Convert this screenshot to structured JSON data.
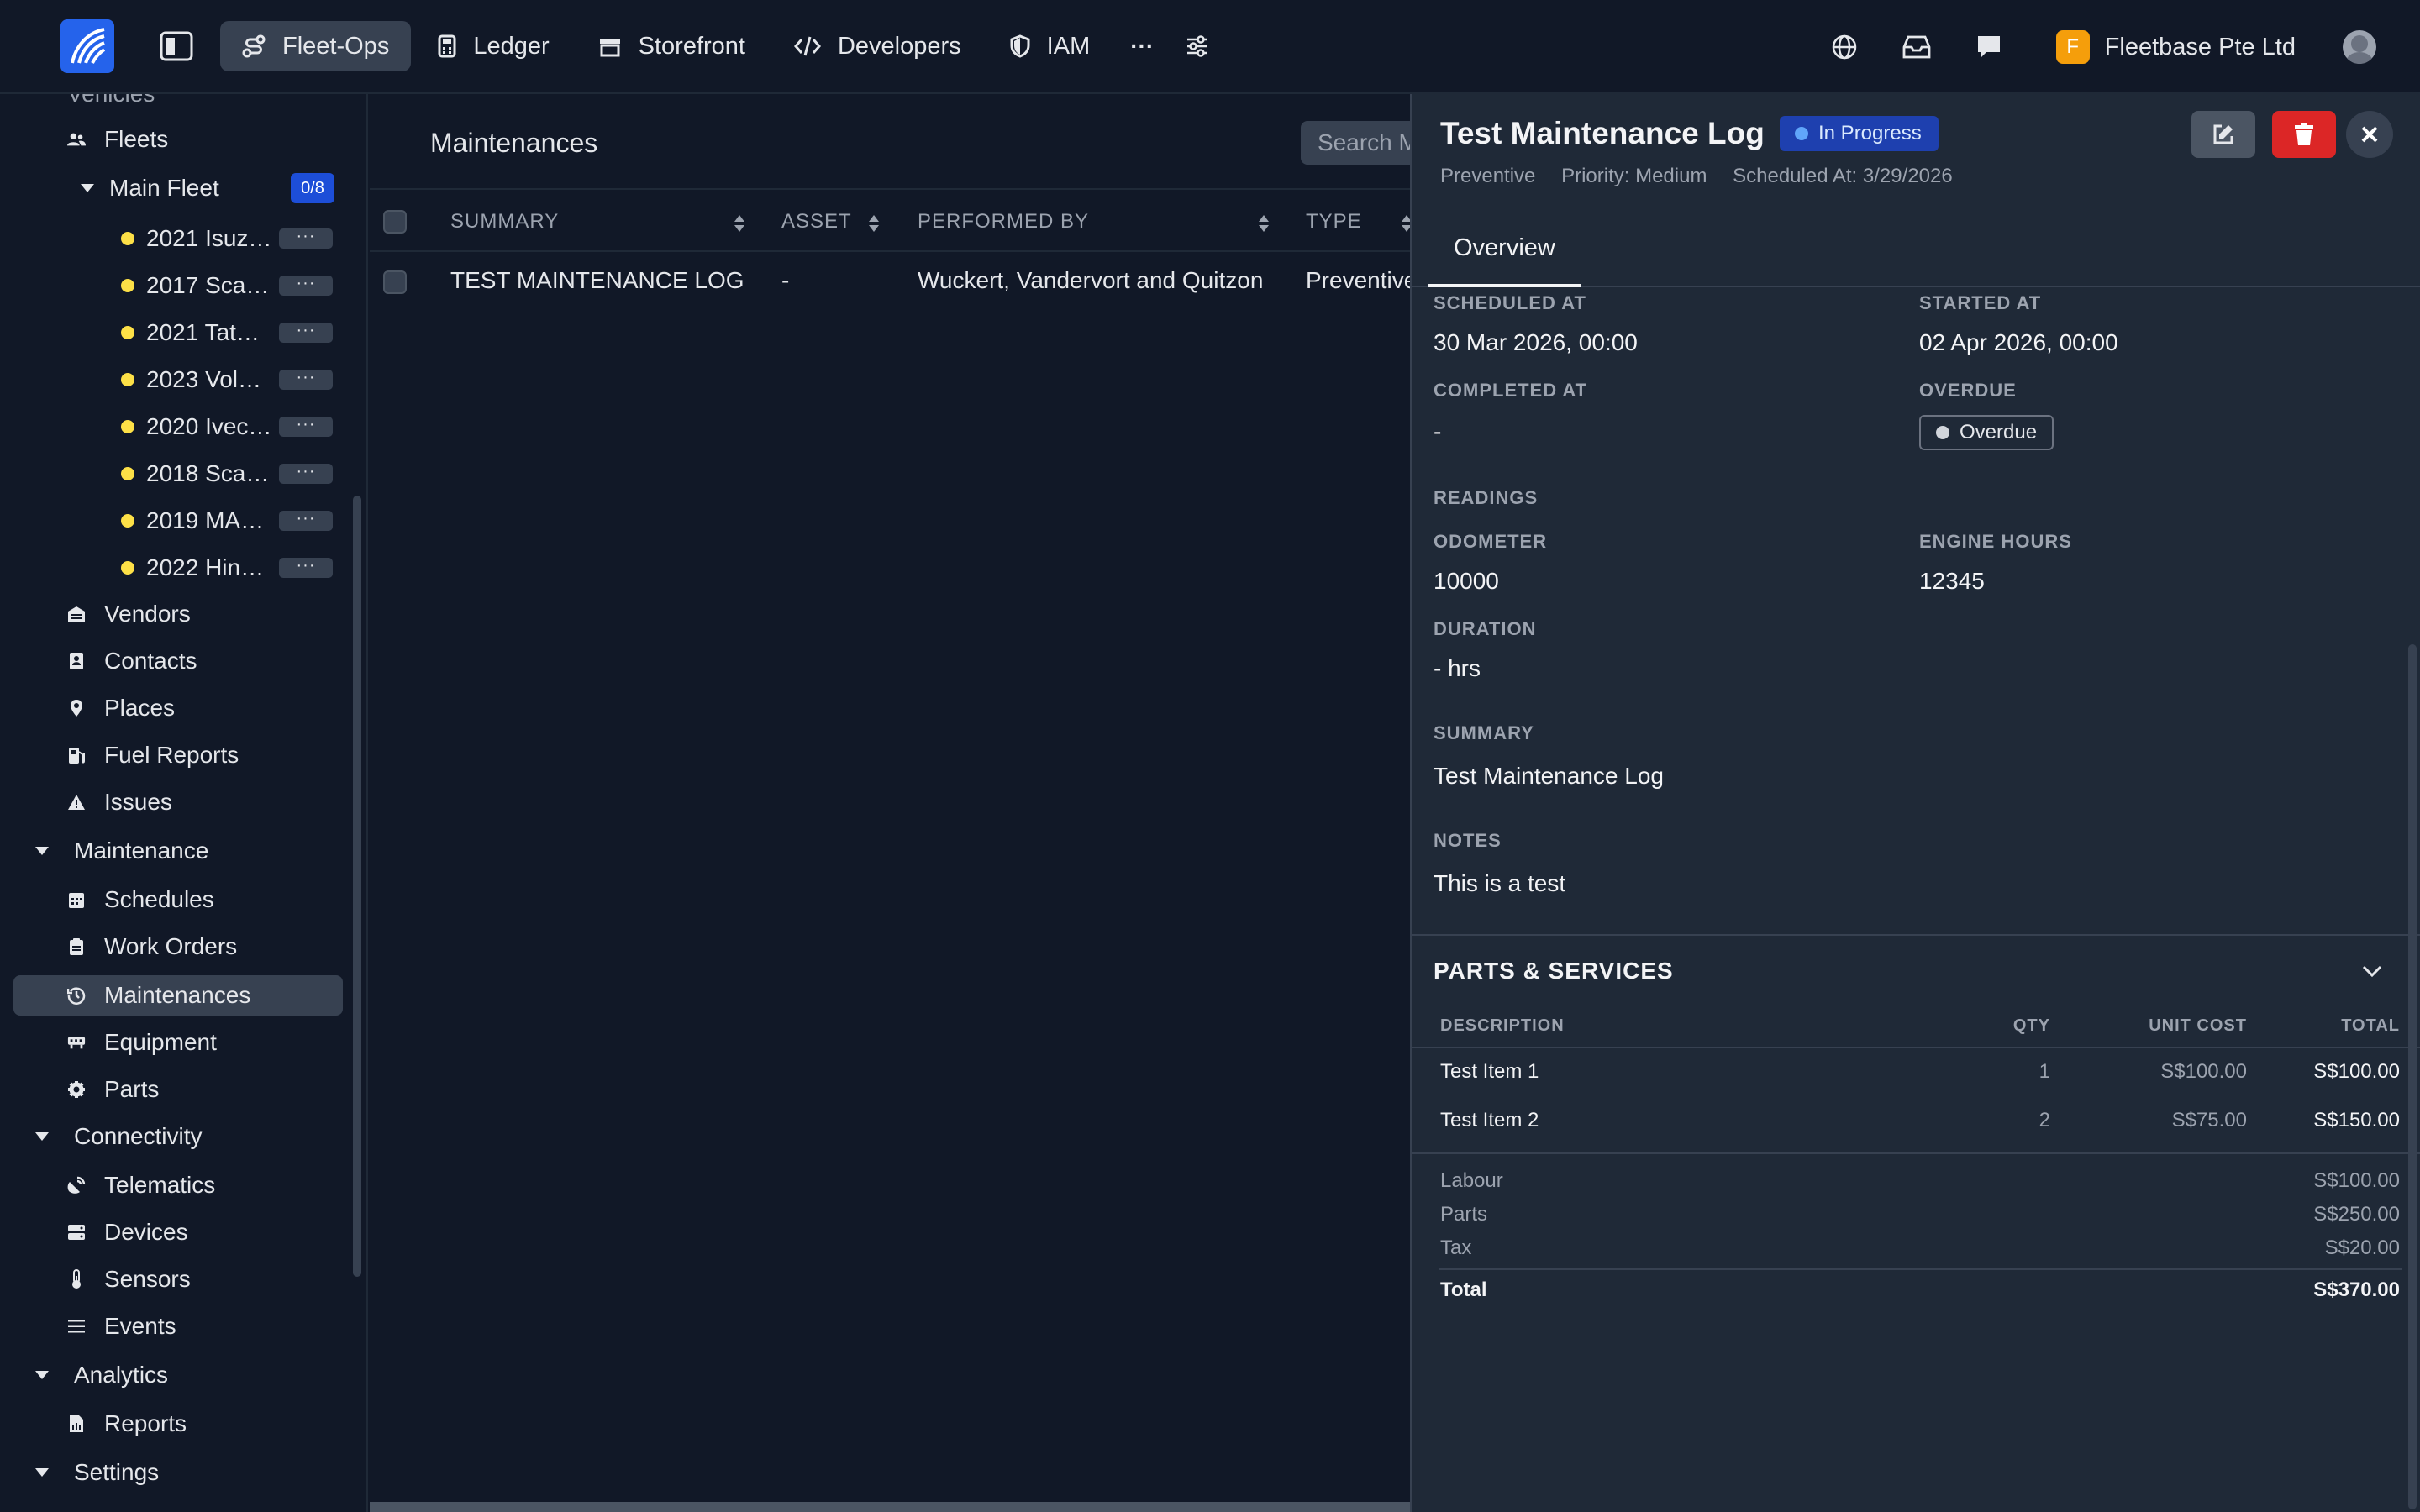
{
  "topbar": {
    "nav": [
      {
        "label": "Fleet-Ops",
        "icon": "route-icon",
        "active": true
      },
      {
        "label": "Ledger",
        "icon": "calculator-icon"
      },
      {
        "label": "Storefront",
        "icon": "store-icon"
      },
      {
        "label": "Developers",
        "icon": "code-icon"
      },
      {
        "label": "IAM",
        "icon": "shield-icon"
      }
    ],
    "more_label": "···",
    "company_initial": "F",
    "company_name": "Fleetbase Pte Ltd"
  },
  "sidebar": {
    "cut_item": "Vehicles",
    "fleets": "Fleets",
    "main_fleet": "Main Fleet",
    "main_fleet_count": "0/8",
    "vehicles": [
      "2021 Isuz…",
      "2017 Sca…",
      "2021 Tat…",
      "2023 Vol…",
      "2020 Ivec…",
      "2018 Sca…",
      "2019 MA…",
      "2022 Hin…"
    ],
    "dots_label": "···",
    "items_top": [
      "Vendors",
      "Contacts",
      "Places",
      "Fuel Reports",
      "Issues"
    ],
    "maintenance_section": "Maintenance",
    "maintenance_items": [
      "Schedules",
      "Work Orders",
      "Maintenances",
      "Equipment",
      "Parts"
    ],
    "connectivity_section": "Connectivity",
    "connectivity_items": [
      "Telematics",
      "Devices",
      "Sensors",
      "Events"
    ],
    "analytics_section": "Analytics",
    "analytics_items": [
      "Reports"
    ],
    "settings_section": "Settings"
  },
  "main": {
    "title": "Maintenances",
    "search_placeholder": "Search Maintenances",
    "columns": [
      "SUMMARY",
      "ASSET",
      "PERFORMED BY",
      "TYPE"
    ],
    "rows": [
      {
        "summary": "TEST MAINTENANCE LOG",
        "asset": "-",
        "performed_by": "Wuckert, Vandervort and Quitzon",
        "type": "Preventive"
      }
    ]
  },
  "panel": {
    "title": "Test Maintenance Log",
    "status": "In Progress",
    "type": "Preventive",
    "priority": "Priority: Medium",
    "scheduled": "Scheduled At: 3/29/2026",
    "tab": "Overview",
    "scheduled_at_label": "SCHEDULED AT",
    "scheduled_at": "30 Mar 2026, 00:00",
    "started_at_label": "STARTED AT",
    "started_at": "02 Apr 2026, 00:00",
    "completed_at_label": "COMPLETED AT",
    "completed_at": "-",
    "overdue_label": "OVERDUE",
    "overdue": "Overdue",
    "readings_label": "READINGS",
    "odometer_label": "ODOMETER",
    "odometer": "10000",
    "engine_hours_label": "ENGINE HOURS",
    "engine_hours": "12345",
    "duration_label": "DURATION",
    "duration": "- hrs",
    "summary_label": "SUMMARY",
    "summary": "Test Maintenance Log",
    "notes_label": "NOTES",
    "notes": "This is a test",
    "parts_title": "PARTS & SERVICES",
    "parts_columns": [
      "DESCRIPTION",
      "QTY",
      "UNIT COST",
      "TOTAL"
    ],
    "parts": [
      {
        "desc": "Test Item 1",
        "qty": "1",
        "unit": "S$100.00",
        "total": "S$100.00"
      },
      {
        "desc": "Test Item 2",
        "qty": "2",
        "unit": "S$75.00",
        "total": "S$150.00"
      }
    ],
    "labour_label": "Labour",
    "labour": "S$100.00",
    "parts_label": "Parts",
    "parts_total": "S$250.00",
    "tax_label": "Tax",
    "tax": "S$20.00",
    "total_label": "Total",
    "total": "S$370.00"
  },
  "colors": {
    "accent": "#2563eb",
    "danger": "#dc2626",
    "badge": "#1e40af",
    "vehicle_dot": "#fde047"
  }
}
